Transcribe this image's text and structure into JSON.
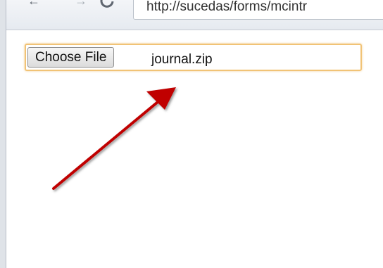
{
  "browser": {
    "address": "http://sucedas/forms/mcintr"
  },
  "form": {
    "choose_file_label": "Choose File",
    "selected_file": "journal.zip"
  },
  "colors": {
    "arrow": "#c00000",
    "focus_border": "#f1c376"
  },
  "icons": {
    "back": "back-arrow-icon",
    "forward": "forward-arrow-icon",
    "reload": "reload-icon",
    "annotation": "red-arrow-icon"
  }
}
